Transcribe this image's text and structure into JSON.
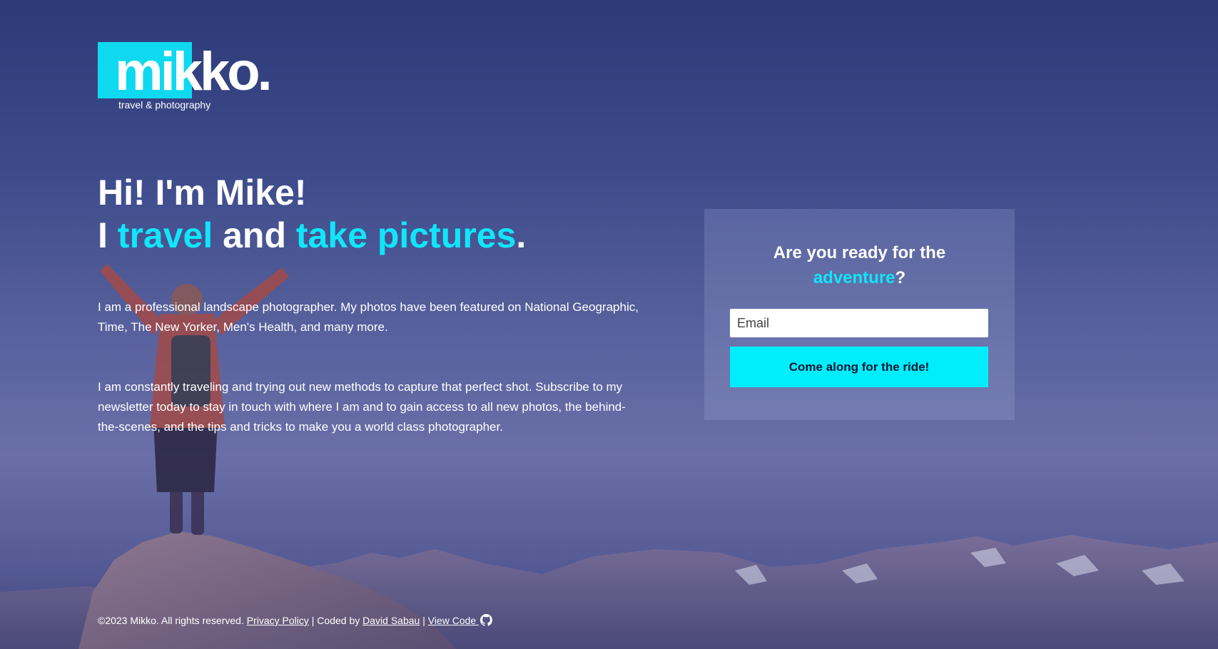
{
  "brand": {
    "logo_text": "mikko.",
    "tagline": "travel & photography",
    "accent_color": "#10e6fa"
  },
  "hero": {
    "line1": "Hi! I'm Mike!",
    "line2_prefix": "I ",
    "line2_accent1": "travel",
    "line2_middle": " and ",
    "line2_accent2": "take pictures",
    "line2_suffix": "."
  },
  "intro": {
    "paragraph1": "I am a professional landscape photographer. My photos have been featured on National Geographic, Time, The New Yorker, Men's Health, and many more.",
    "paragraph2": "I am constantly traveling and trying out new methods to capture that perfect shot. Subscribe to my newsletter today to stay in touch with where I am and to gain access to all new photos, the behind-the-scenes, and the tips and tricks to make you a world class photographer."
  },
  "signup": {
    "title_line1": "Are you ready for the",
    "title_accent": "adventure",
    "title_suffix": "?",
    "email_placeholder": "Email",
    "button_label": "Come along for the ride!",
    "button_color": "#00eefc"
  },
  "footer": {
    "copyright": "©2023 Mikko. All rights reserved. ",
    "privacy_label": "Privacy Policy",
    "sep1": " | Coded by ",
    "author_label": "David Sabau",
    "sep2": " | ",
    "view_code_label": "View Code ",
    "github_icon": "github-icon"
  }
}
